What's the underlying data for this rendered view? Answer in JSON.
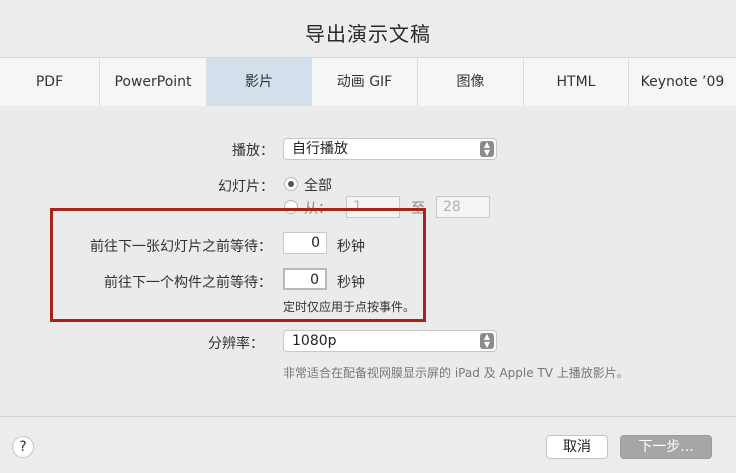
{
  "window": {
    "title": "导出演示文稿"
  },
  "tabs": [
    {
      "label": "PDF"
    },
    {
      "label": "PowerPoint"
    },
    {
      "label": "影片"
    },
    {
      "label": "动画 GIF"
    },
    {
      "label": "图像"
    },
    {
      "label": "HTML"
    },
    {
      "label": "Keynote ’09"
    }
  ],
  "active_tab": "影片",
  "playback": {
    "label": "播放：",
    "value": "自行播放"
  },
  "slides": {
    "label": "幻灯片：",
    "all_label": "全部",
    "from_label": "从：",
    "from_value": "1",
    "to_label": "至",
    "to_value": "28"
  },
  "timing": {
    "slide_wait_label": "前往下一张幻灯片之前等待：",
    "slide_wait_value": "0",
    "build_wait_label": "前往下一个构件之前等待：",
    "build_wait_value": "0",
    "unit": "秒钟",
    "note": "定时仅应用于点按事件。"
  },
  "resolution": {
    "label": "分辨率：",
    "value": "1080p",
    "note": "非常适合在配备视网膜显示屏的 iPad 及 Apple TV 上播放影片。"
  },
  "footer": {
    "help": "?",
    "cancel": "取消",
    "next": "下一步..."
  }
}
